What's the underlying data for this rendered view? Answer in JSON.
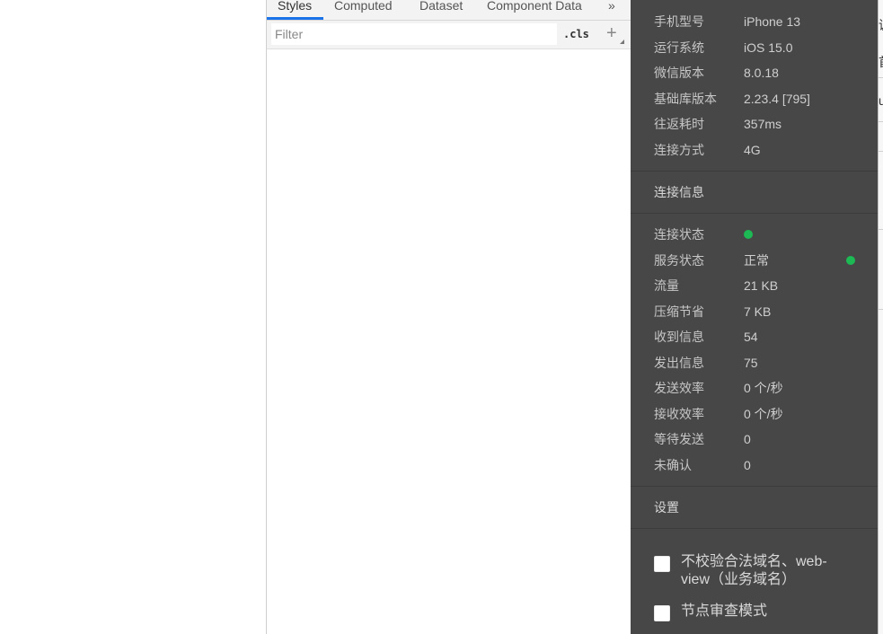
{
  "devtools": {
    "tabs": [
      "Styles",
      "Computed",
      "Dataset",
      "Component Data"
    ],
    "more_icon": "»",
    "filter": {
      "placeholder": "Filter",
      "value": ""
    },
    "cls_label": ".cls",
    "add_icon": "+"
  },
  "panel": {
    "device_rows": [
      {
        "label": "手机型号",
        "value": "iPhone 13"
      },
      {
        "label": "运行系统",
        "value": "iOS 15.0"
      },
      {
        "label": "微信版本",
        "value": "8.0.18"
      },
      {
        "label": "基础库版本",
        "value": "2.23.4 [795]"
      },
      {
        "label": "往返耗时",
        "value": "357ms"
      },
      {
        "label": "连接方式",
        "value": "4G"
      }
    ],
    "connection_title": "连接信息",
    "connection_rows": [
      {
        "label": "连接状态",
        "value": ""
      },
      {
        "label": "服务状态",
        "value": "正常"
      },
      {
        "label": "流量",
        "value": "21 KB"
      },
      {
        "label": "压缩节省",
        "value": "7 KB"
      },
      {
        "label": "收到信息",
        "value": "54"
      },
      {
        "label": "发出信息",
        "value": "75"
      },
      {
        "label": "发送效率",
        "value": "0 个/秒"
      },
      {
        "label": "接收效率",
        "value": "0 个/秒"
      },
      {
        "label": "等待发送",
        "value": "0"
      },
      {
        "label": "未确认",
        "value": "0"
      }
    ],
    "settings_title": "设置",
    "settings": [
      {
        "label": "不校验合法域名、web-view（业务域名）",
        "checked": false
      },
      {
        "label": "节点审查模式",
        "checked": false
      }
    ],
    "status_color": "#1db954"
  },
  "strip": [
    "调",
    "首",
    "u"
  ]
}
